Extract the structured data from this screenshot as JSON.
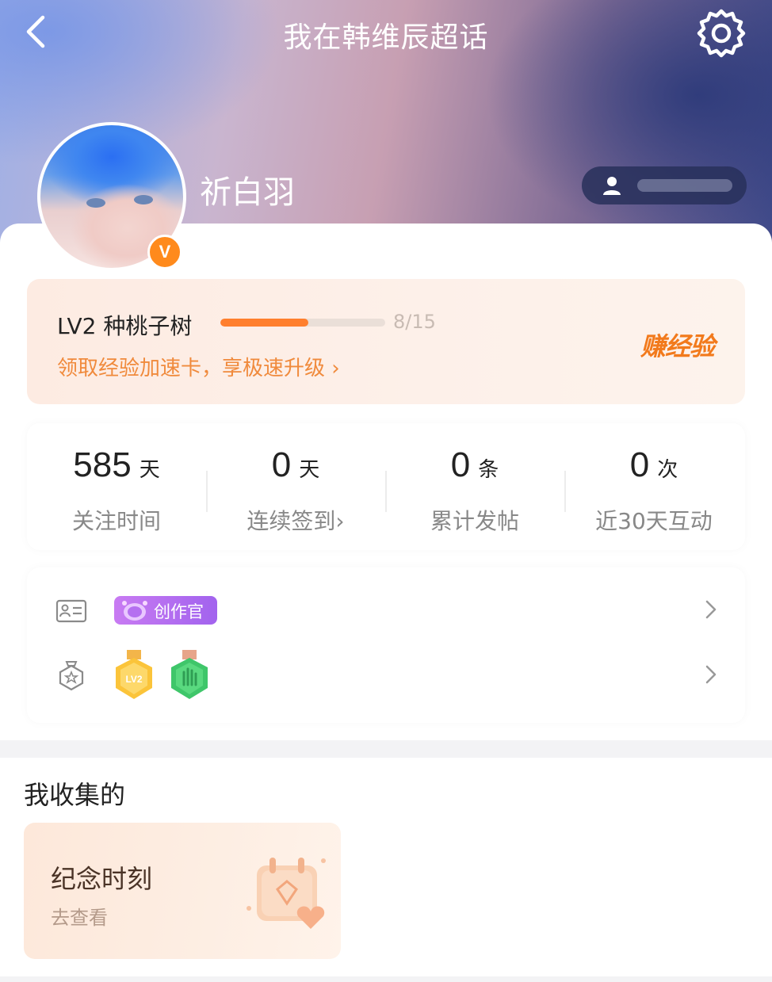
{
  "topbar": {
    "title": "我在韩维辰超话"
  },
  "profile": {
    "username": "祈白羽",
    "verified_badge": "V"
  },
  "level": {
    "label": "LV2 种桃子树",
    "progress_text": "8/15",
    "progress_fraction": 0.533,
    "promo": "领取经验加速卡，享极速升级 ›",
    "earn_label": "赚经验"
  },
  "stats": [
    {
      "value": "585",
      "unit": "天",
      "label": "关注时间"
    },
    {
      "value": "0",
      "unit": "天",
      "label": "连续签到›"
    },
    {
      "value": "0",
      "unit": "条",
      "label": "累计发帖"
    },
    {
      "value": "0",
      "unit": "次",
      "label": "近30天互动"
    }
  ],
  "badges": {
    "creator_tag": "创作官",
    "medals": [
      "LV2"
    ]
  },
  "collection": {
    "section_title": "我收集的",
    "card_title": "纪念时刻",
    "card_action": "去查看"
  },
  "colors": {
    "accent_orange": "#ff7f2e",
    "promo_orange": "#f08a3c",
    "creator_purple": "#a263ee"
  }
}
